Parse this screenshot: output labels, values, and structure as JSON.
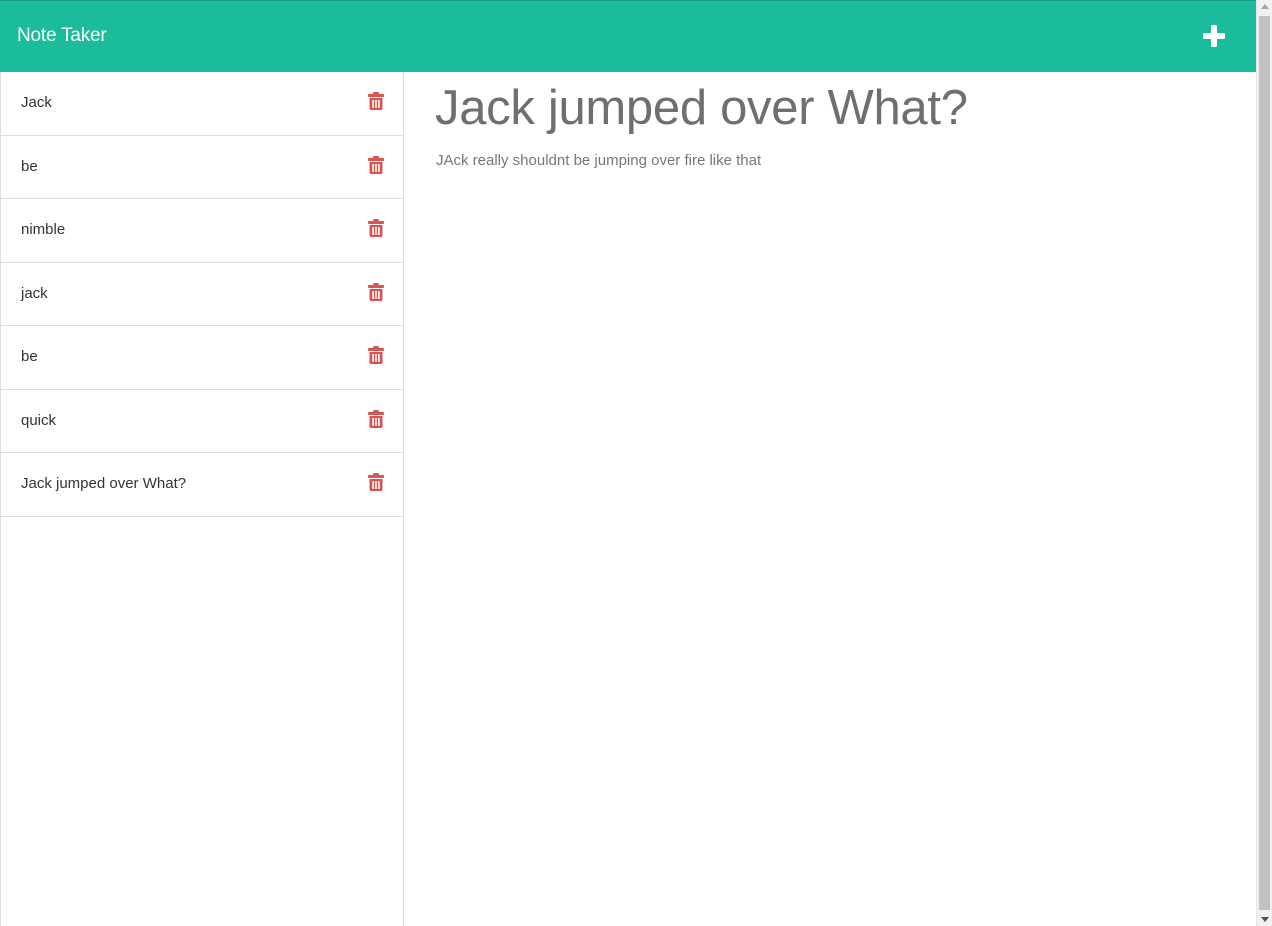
{
  "app": {
    "title": "Note Taker",
    "accent_color": "#1abc9c",
    "delete_icon_color": "#d9534f"
  },
  "toolbar": {
    "new_note_icon": "plus-icon"
  },
  "notes": [
    {
      "title": "Jack"
    },
    {
      "title": "be"
    },
    {
      "title": "nimble"
    },
    {
      "title": "jack"
    },
    {
      "title": "be"
    },
    {
      "title": "quick"
    },
    {
      "title": "Jack jumped over What?"
    }
  ],
  "note_item_icon": "trash-icon",
  "active_note": {
    "title": "Jack jumped over What?",
    "text": "JAck really shouldnt be jumping over fire like that"
  }
}
